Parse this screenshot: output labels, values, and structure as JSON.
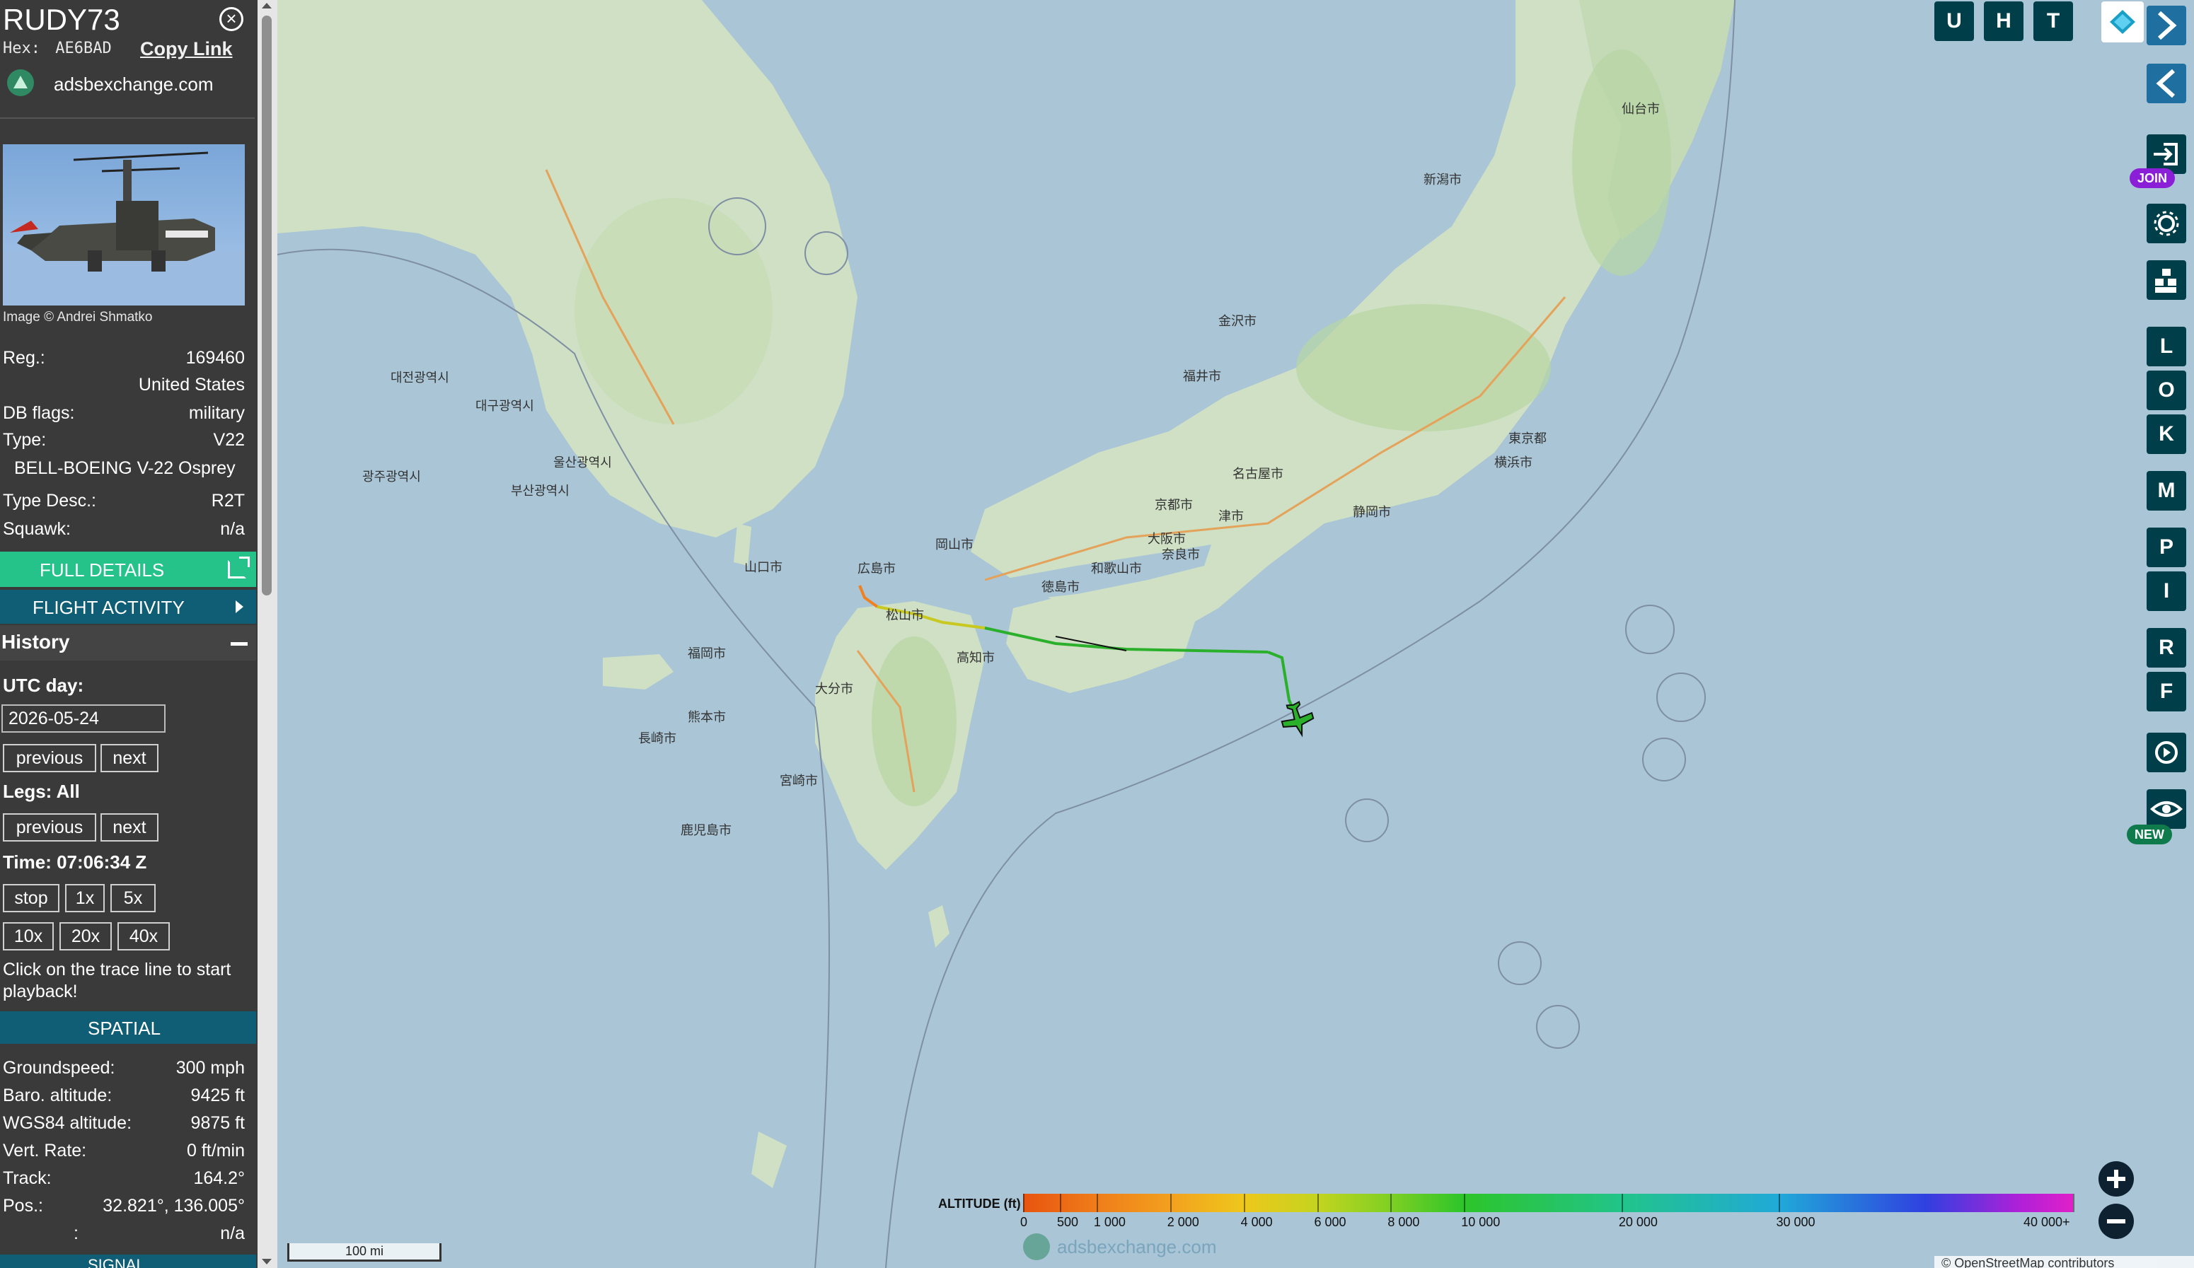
{
  "info_panel": {
    "callsign": "RUDY73",
    "hex_label": "Hex:",
    "hex_value": "AE6BAD",
    "copy_link": "Copy Link",
    "source": "adsbexchange.com",
    "image_credit": "Image © Andrei Shmatko",
    "reg_label": "Reg.:",
    "reg_value": "169460",
    "country": "United States",
    "dbflags_label": "DB flags:",
    "dbflags_value": "military",
    "type_label": "Type:",
    "type_value": "V22",
    "type_full": "BELL-BOEING V-22 Osprey",
    "typedesc_label": "Type Desc.:",
    "typedesc_value": "R2T",
    "squawk_label": "Squawk:",
    "squawk_value": "n/a",
    "full_details": "FULL DETAILS",
    "flight_activity": "FLIGHT ACTIVITY"
  },
  "history": {
    "title": "History",
    "utc_day_label": "UTC day:",
    "date_value": "2026-05-24",
    "previous": "previous",
    "next": "next",
    "legs_label": "Legs: All",
    "time_label": "Time: 07:06:34 Z",
    "stop": "stop",
    "speed_1x": "1x",
    "speed_5x": "5x",
    "speed_10x": "10x",
    "speed_20x": "20x",
    "speed_40x": "40x",
    "hint": "Click on the trace line to start playback!"
  },
  "spatial": {
    "title": "SPATIAL",
    "groundspeed_label": "Groundspeed:",
    "groundspeed_value": "300 mph",
    "baro_label": "Baro. altitude:",
    "baro_value": "9425 ft",
    "wgs_label": "WGS84 altitude:",
    "wgs_value": "9875 ft",
    "vert_label": "Vert. Rate:",
    "vert_value": "0 ft/min",
    "track_label": "Track:",
    "track_value": "164.2°",
    "pos_label": "Pos.:",
    "pos_value": "32.821°, 136.005°",
    "extra_label": ":",
    "extra_value": "n/a",
    "next_section": "SIGNAL"
  },
  "map_controls": {
    "btn_u": "U",
    "btn_h": "H",
    "btn_t": "T",
    "join_badge": "JOIN",
    "new_badge": "NEW",
    "letters": [
      "L",
      "O",
      "K",
      "M",
      "P",
      "I",
      "R",
      "F"
    ]
  },
  "legend": {
    "title": "ALTITUDE (ft)",
    "ticks": [
      "0",
      "500",
      "1 000",
      "2 000",
      "4 000",
      "6 000",
      "8 000",
      "10 000",
      "20 000",
      "30 000",
      "40 000+"
    ],
    "watermark": "adsbexchange.com"
  },
  "scale": "100 mi",
  "attribution": "© OpenStreetMap contributors",
  "map_labels": {
    "korea_cities": [
      "울산광역시",
      "부산광역시",
      "대구광역시",
      "광주광역시",
      "대전광역시"
    ],
    "japan_cities": [
      "広島市",
      "山口市",
      "福岡市",
      "長崎市",
      "熊本市",
      "鹿児島市",
      "松山市",
      "高知市",
      "大阪市",
      "京都市",
      "名古屋市",
      "金沢市",
      "福井市",
      "東京都",
      "横浜市",
      "仙台市",
      "新潟市",
      "静岡市",
      "津市",
      "和歌山市",
      "徳島市",
      "岡山市",
      "奈良市",
      "大分市",
      "宮崎市"
    ]
  },
  "colors": {
    "sidebar_bg": "#3a3a3a",
    "accent_green": "#25c289",
    "accent_teal": "#0f5e75",
    "map_button": "#003f4a",
    "chevron_button": "#1f6fa0",
    "join_badge": "#8b1fd8",
    "new_badge": "#0f7a4c",
    "trace_green": "#2ab02a",
    "trace_orange": "#f08020"
  }
}
